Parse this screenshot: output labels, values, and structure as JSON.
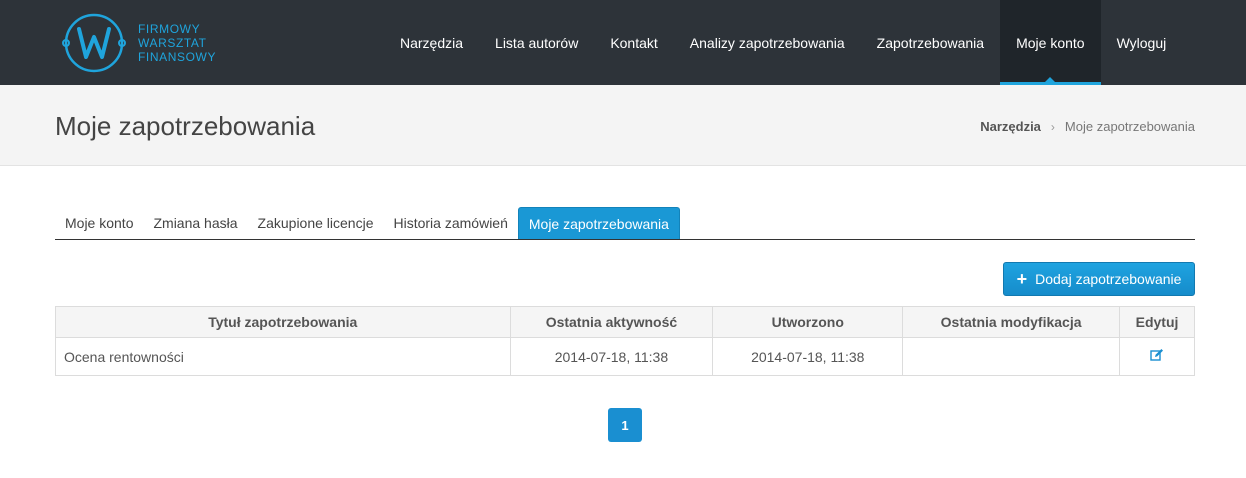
{
  "brand": {
    "logo_letter": "W",
    "lines": [
      "FIRMOWY",
      "WARSZTAT",
      "FINANSOWY"
    ],
    "color": "#1fa4dc"
  },
  "nav": {
    "items": [
      {
        "label": "Narzędzia"
      },
      {
        "label": "Lista autorów"
      },
      {
        "label": "Kontakt"
      },
      {
        "label": "Analizy zapotrzebowania"
      },
      {
        "label": "Zapotrzebowania"
      },
      {
        "label": "Moje konto",
        "active": true
      },
      {
        "label": "Wyloguj"
      }
    ]
  },
  "header": {
    "title": "Moje zapotrzebowania",
    "breadcrumb": {
      "link": "Narzędzia",
      "separator": "›",
      "current": "Moje zapotrzebowania"
    }
  },
  "tabs": [
    {
      "label": "Moje konto"
    },
    {
      "label": "Zmiana hasła"
    },
    {
      "label": "Zakupione licencje"
    },
    {
      "label": "Historia zamówień"
    },
    {
      "label": "Moje zapotrzebowania",
      "active": true
    }
  ],
  "toolbar": {
    "add_label": "Dodaj zapotrzebowanie",
    "add_icon": "plus-icon"
  },
  "table": {
    "columns": [
      "Tytuł zapotrzebowania",
      "Ostatnia aktywność",
      "Utworzono",
      "Ostatnia modyfikacja",
      "Edytuj"
    ],
    "rows": [
      {
        "title": "Ocena rentowności",
        "last_activity": "2014-07-18, 11:38",
        "created": "2014-07-18, 11:38",
        "modified": "",
        "edit_icon": "edit-icon"
      }
    ]
  },
  "pagination": {
    "current": "1"
  },
  "colors": {
    "accent": "#1a98d5",
    "navbar": "#2d3339"
  }
}
